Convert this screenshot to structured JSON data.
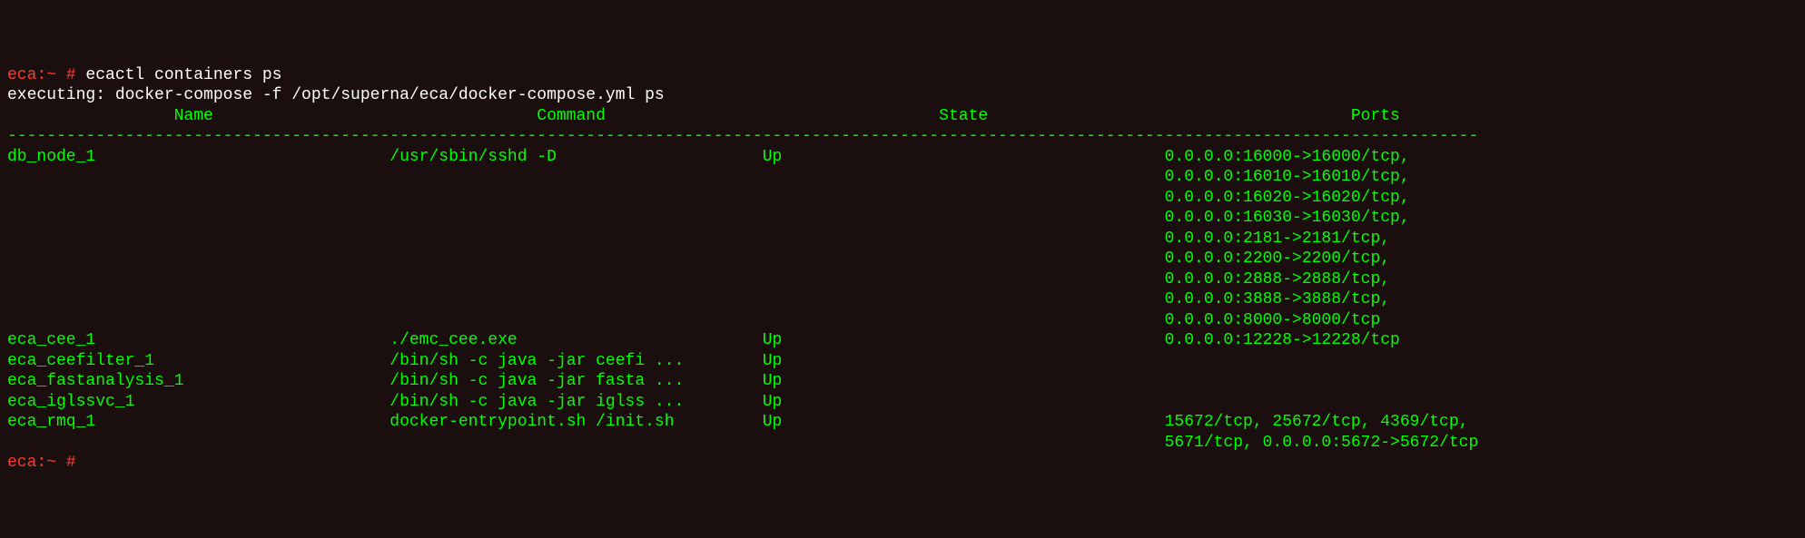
{
  "prompt": "eca:~ #",
  "command": "ecactl containers ps",
  "executing_line": "executing: docker-compose -f /opt/superna/eca/docker-compose.yml ps",
  "columns": {
    "name_header": "Name",
    "command_header": "Command",
    "state_header": "State",
    "ports_header": "Ports"
  },
  "layout": {
    "name_col_width": 39,
    "command_col_width": 38,
    "state_col_width": 41,
    "name_header_pad": 17,
    "cmd_header_pad": 54,
    "state_header_pad": 95,
    "ports_header_pad": 137,
    "divider_width": 150
  },
  "rows": [
    {
      "name": "db_node_1",
      "command": "/usr/sbin/sshd -D",
      "state": "Up",
      "ports": [
        "0.0.0.0:16000->16000/tcp,",
        "0.0.0.0:16010->16010/tcp,",
        "0.0.0.0:16020->16020/tcp,",
        "0.0.0.0:16030->16030/tcp,",
        "0.0.0.0:2181->2181/tcp,",
        "0.0.0.0:2200->2200/tcp,",
        "0.0.0.0:2888->2888/tcp,",
        "0.0.0.0:3888->3888/tcp,",
        "0.0.0.0:8000->8000/tcp"
      ]
    },
    {
      "name": "eca_cee_1",
      "command": "./emc_cee.exe",
      "state": "Up",
      "ports": [
        "0.0.0.0:12228->12228/tcp"
      ]
    },
    {
      "name": "eca_ceefilter_1",
      "command": "/bin/sh -c java -jar ceefi ...",
      "state": "Up",
      "ports": []
    },
    {
      "name": "eca_fastanalysis_1",
      "command": "/bin/sh -c java -jar fasta ...",
      "state": "Up",
      "ports": []
    },
    {
      "name": "eca_iglssvc_1",
      "command": "/bin/sh -c java -jar iglss ...",
      "state": "Up",
      "ports": []
    },
    {
      "name": "eca_rmq_1",
      "command": "docker-entrypoint.sh /init.sh",
      "state": "Up",
      "ports": [
        "15672/tcp, 25672/tcp, 4369/tcp,",
        "5671/tcp, 0.0.0.0:5672->5672/tcp"
      ]
    }
  ]
}
